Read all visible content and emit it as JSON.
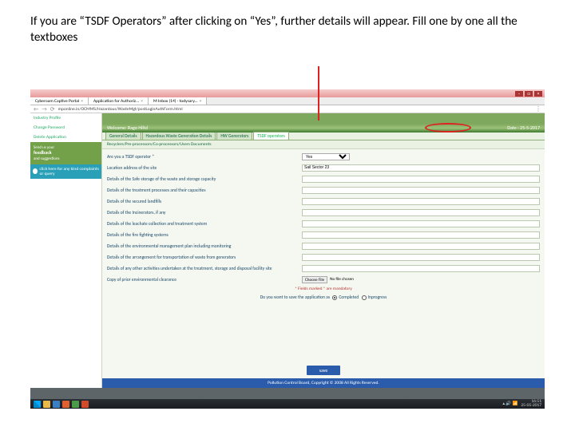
{
  "instruction": "If you are “TSDF Operators” after clicking on “Yes”, further details will appear. Fill one by one all the textboxes",
  "browser": {
    "tabs": [
      {
        "label": "Cyberoam Captive Portal"
      },
      {
        "label": "Application for Authoriz..."
      },
      {
        "label": "M Inbox (14) - todysary..."
      }
    ],
    "url": "mponline.in/OCMMS/Hazardous/WasteMgt/postLoginAuthForm.html",
    "menu_icon": "⋮"
  },
  "sidebar": {
    "items": [
      "Industry Profile",
      "Change Password",
      "Delete Application"
    ],
    "feedback": {
      "s1": "Send us your",
      "s2": "feedback",
      "s3": "and suggestions"
    },
    "complaint": "click here for any kind complaints or query"
  },
  "hero": {
    "welcome": "Welcome: Rago Hiltd",
    "date": "Date : 25-5-2017"
  },
  "formtabs": [
    "General Details",
    "Hazardous Waste Generation Details",
    "HW Generators",
    "TSDF operators"
  ],
  "subline": "Recyclers/Pre-processors/Co-processors/Users   Documents",
  "form": {
    "q_operator": "Are you a TSDF operator *",
    "operator_value": "Yes",
    "rows": [
      "Location address of the site",
      "Details of the Safe storage of the waste and storage capacity",
      "Details of the treatment processes and their capacities",
      "Details of the secured landfills",
      "Details of the Incinerators, if any",
      "Details of the leachate collection and treatment system",
      "Details of the fire fighting systems",
      "Details of the environmental management plan including monitoring",
      "Details of the arrangement for transportation of waste from generators",
      "Details of any other activities undertaken at the treatment, storage and disposal facility site"
    ],
    "input_value": "Sail Sector 23",
    "file_label": "Copy of prior environmental clearance",
    "file_btn": "Choose File",
    "file_status": "No file chosen"
  },
  "mandatory_note": "* Fields marked * are mandatory",
  "save_question": "Do you want to save the application as   ",
  "save_opts": {
    "a": "Completed",
    "b": "Inprogress"
  },
  "save_btn": "save",
  "footer_text": "Pollution Control Board, Copyright © 2008 All Rights Reserved.",
  "taskbar": {
    "time": "16:51",
    "date": "25-05-2017"
  }
}
